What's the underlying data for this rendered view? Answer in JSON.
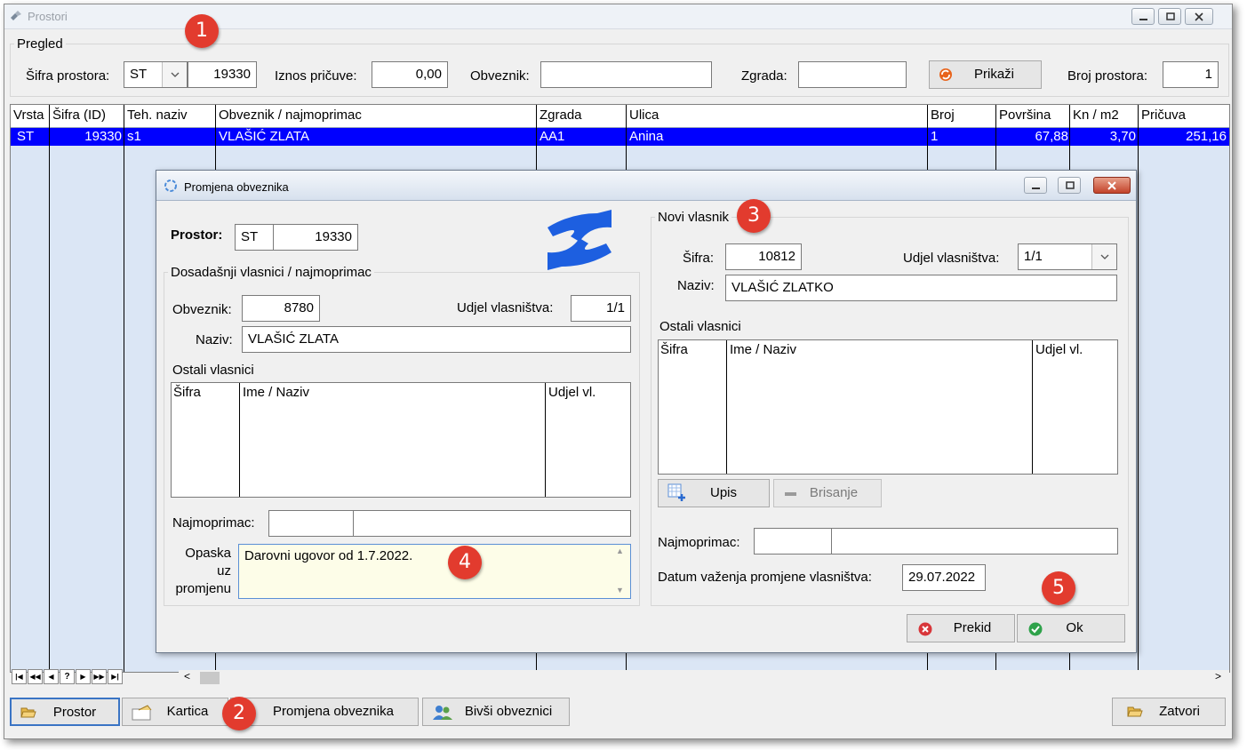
{
  "window": {
    "title": "Prostori"
  },
  "filter": {
    "legend": "Pregled",
    "sifra_label": "Šifra prostora:",
    "sifra_prefix": "ST",
    "sifra_value": "19330",
    "iznos_label": "Iznos pričuve:",
    "iznos_value": "0,00",
    "obveznik_label": "Obveznik:",
    "obveznik_value": "",
    "zgrada_label": "Zgrada:",
    "zgrada_value": "",
    "prikazi_label": "Prikaži",
    "broj_label": "Broj prostora:",
    "broj_value": "1"
  },
  "table": {
    "columns": [
      "Vrsta",
      "Šifra (ID)",
      "Teh. naziv",
      "Obveznik / najmoprimac",
      "Zgrada",
      "Ulica",
      "Broj",
      "Površina",
      "Kn / m2",
      "Pričuva"
    ],
    "rows": [
      [
        "ST",
        "19330",
        "s1",
        "VLAŠIĆ ZLATA",
        "AA1",
        "Anina",
        "1",
        "67,88",
        "3,70",
        "251,16"
      ]
    ]
  },
  "dialog": {
    "title": "Promjena obveznika",
    "prostor_label": "Prostor:",
    "prostor_prefix": "ST",
    "prostor_value": "19330",
    "old_owners": {
      "legend": "Dosadašnji vlasnici / najmoprimac",
      "obveznik_label": "Obveznik:",
      "obveznik_value": "8780",
      "udjel_label": "Udjel vlasništva:",
      "udjel_value": "1/1",
      "naziv_label": "Naziv:",
      "naziv_value": "VLAŠIĆ ZLATA",
      "ostali_label": "Ostali vlasnici",
      "cols": [
        "Šifra",
        "Ime / Naziv",
        "Udjel vl."
      ],
      "najmoprimac_label": "Najmoprimac:",
      "najmoprimac_code": "",
      "najmoprimac_name": "",
      "opaska_label_1": "Opaska",
      "opaska_label_2": "uz",
      "opaska_label_3": "promjenu",
      "opaska_value": "Darovni ugovor od 1.7.2022."
    },
    "new_owner": {
      "legend": "Novi vlasnik",
      "sifra_label": "Šifra:",
      "sifra_value": "10812",
      "udjel_label": "Udjel vlasništva:",
      "udjel_value": "1/1",
      "naziv_label": "Naziv:",
      "naziv_value": "VLAŠIĆ ZLATKO",
      "ostali_label": "Ostali vlasnici",
      "cols": [
        "Šifra",
        "Ime / Naziv",
        "Udjel vl."
      ],
      "upis_label": "Upis",
      "brisanje_label": "Brisanje",
      "najmoprimac_label": "Najmoprimac:",
      "najmoprimac_code": "",
      "najmoprimac_name": "",
      "datum_label": "Datum važenja promjene vlasništva:",
      "datum_value": "29.07.2022"
    },
    "prekid_label": "Prekid",
    "ok_label": "Ok"
  },
  "bottom": {
    "prostor_label": "Prostor",
    "kartica_label": "Kartica",
    "promjena_label": "Promjena obveznika",
    "bivsi_label": "Bivši obveznici",
    "zatvori_label": "Zatvori"
  },
  "badges": [
    "1",
    "2",
    "3",
    "4",
    "5"
  ],
  "colors": {
    "selection": "#0000ff",
    "grid_bg": "#dbe6f5",
    "badge": "#e23b2e",
    "memo_bg": "#fdfde8"
  }
}
